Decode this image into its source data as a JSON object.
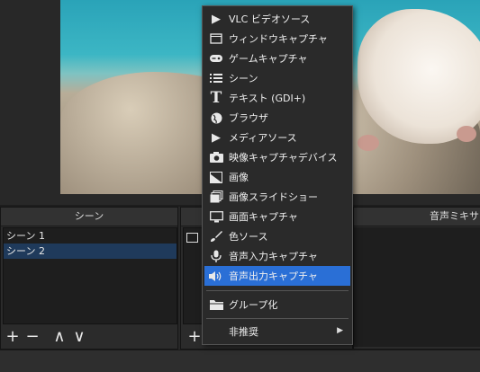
{
  "menu": {
    "items": [
      {
        "label": "VLC ビデオソース",
        "icon": "play-icon"
      },
      {
        "label": "ウィンドウキャプチャ",
        "icon": "window-icon"
      },
      {
        "label": "ゲームキャプチャ",
        "icon": "gamepad-icon"
      },
      {
        "label": "シーン",
        "icon": "list-icon"
      },
      {
        "label": "テキスト (GDI+)",
        "icon": "text-icon"
      },
      {
        "label": "ブラウザ",
        "icon": "globe-icon"
      },
      {
        "label": "メディアソース",
        "icon": "play-icon"
      },
      {
        "label": "映像キャプチャデバイス",
        "icon": "camera-icon"
      },
      {
        "label": "画像",
        "icon": "image-icon"
      },
      {
        "label": "画像スライドショー",
        "icon": "slideshow-icon"
      },
      {
        "label": "画面キャプチャ",
        "icon": "monitor-icon"
      },
      {
        "label": "色ソース",
        "icon": "brush-icon"
      },
      {
        "label": "音声入力キャプチャ",
        "icon": "microphone-icon"
      },
      {
        "label": "音声出力キャプチャ",
        "icon": "speaker-icon"
      }
    ],
    "group": {
      "label": "グループ化",
      "icon": "folder-icon"
    },
    "deprecated": {
      "label": "非推奨",
      "icon": "chevron-right-icon"
    },
    "highlighted_index": 13
  },
  "scenes": {
    "title": "シーン",
    "items": [
      "シーン 1",
      "シーン 2"
    ],
    "selected_index": 1,
    "toolbar": [
      "+",
      "−",
      "∧",
      "∨"
    ]
  },
  "sources": {
    "add": "+"
  },
  "mixer": {
    "title": "音声ミキサ"
  },
  "colors": {
    "highlight": "#2a6fd6",
    "selected_scene": "#1f3a5b",
    "panel": "#2b2b2b"
  }
}
